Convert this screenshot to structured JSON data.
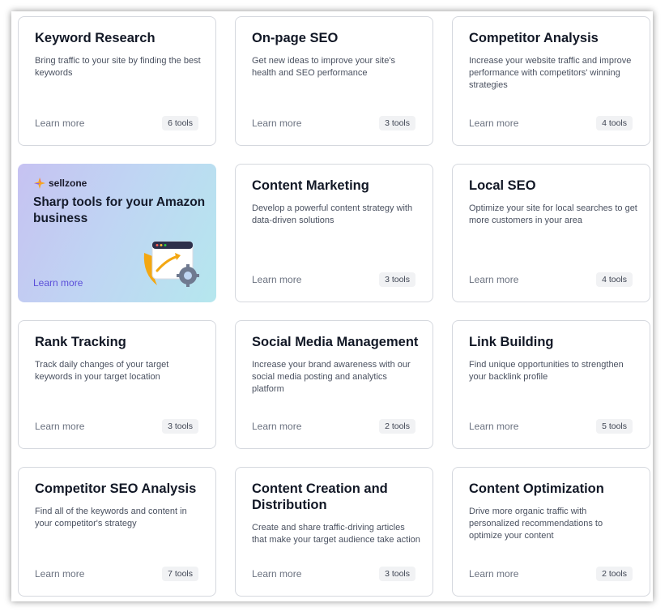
{
  "learn_more": "Learn more",
  "cards": [
    {
      "title": "Keyword Research",
      "desc": "Bring traffic to your site by finding the best keywords",
      "tools": "6 tools"
    },
    {
      "title": "On-page SEO",
      "desc": "Get new ideas to improve your site's health and SEO performance",
      "tools": "3 tools"
    },
    {
      "title": "Competitor Analysis",
      "desc": "Increase your website traffic and improve performance with competitors' winning strategies",
      "tools": "4 tools"
    },
    {
      "title": "Content Marketing",
      "desc": "Develop a powerful content strategy with data-driven solutions",
      "tools": "3 tools"
    },
    {
      "title": "Local SEO",
      "desc": "Optimize your site for local searches to get more customers in your area",
      "tools": "4 tools"
    },
    {
      "title": "Rank Tracking",
      "desc": "Track daily changes of your target keywords in your target location",
      "tools": "3 tools"
    },
    {
      "title": "Social Media Management",
      "desc": "Increase your brand awareness with our social media posting and analytics platform",
      "tools": "2 tools"
    },
    {
      "title": "Link Building",
      "desc": "Find unique opportunities to strengthen your backlink profile",
      "tools": "5 tools"
    },
    {
      "title": "Competitor SEO Analysis",
      "desc": "Find all of the keywords and content in your competitor's strategy",
      "tools": "7 tools"
    },
    {
      "title": "Content Creation and Distribution",
      "desc": "Create and share traffic-driving articles that make your target audience take action",
      "tools": "3 tools"
    },
    {
      "title": "Content Optimization",
      "desc": "Drive more organic traffic with personalized recommendations to optimize your content",
      "tools": "2 tools"
    }
  ],
  "promo": {
    "brand": "sellzone",
    "title": "Sharp tools for your Amazon business",
    "link": "Learn more",
    "accent_color": "#5b4fd9"
  }
}
